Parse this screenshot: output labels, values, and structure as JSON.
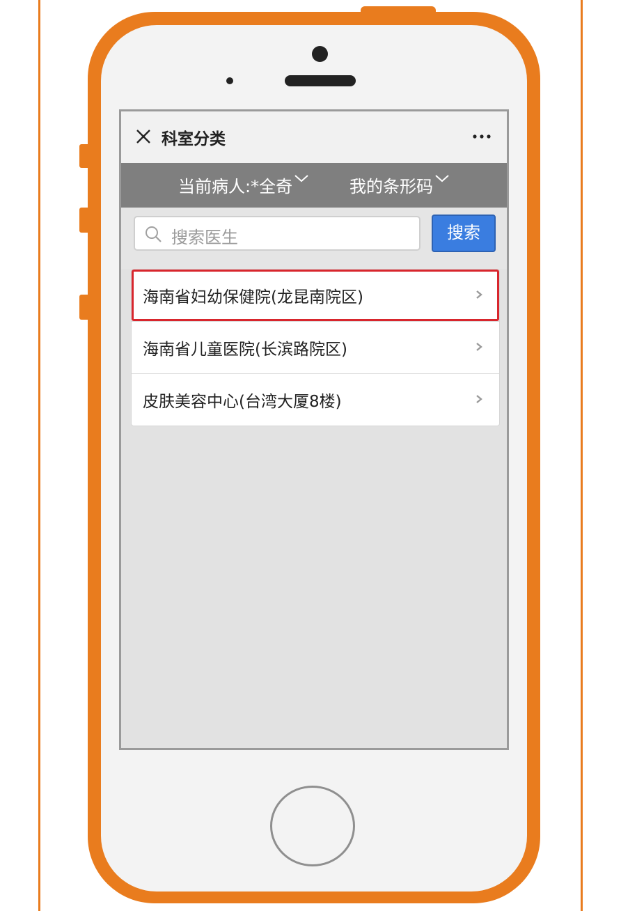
{
  "header": {
    "title": "科室分类"
  },
  "patient_bar": {
    "patient_label": "当前病人:*全奇",
    "barcode_label": "我的条形码"
  },
  "search": {
    "placeholder": "搜索医生",
    "button_label": "搜索"
  },
  "hospitals": [
    {
      "name": "海南省妇幼保健院(龙昆南院区)",
      "selected": true
    },
    {
      "name": "海南省儿童医院(长滨路院区)",
      "selected": false
    },
    {
      "name": "皮肤美容中心(台湾大厦8楼)",
      "selected": false
    }
  ],
  "icons": {
    "close": "close-icon",
    "more": "more-icon",
    "dropdown": "chevron-down-icon",
    "search": "search-icon",
    "arrow": "chevron-right-icon"
  },
  "colors": {
    "phone_frame": "#e97c1e",
    "patient_bar_bg": "#7f7f7f",
    "search_button": "#3a7de0",
    "selected_outline": "#d8262d",
    "screen_bg": "#e2e2e2"
  }
}
